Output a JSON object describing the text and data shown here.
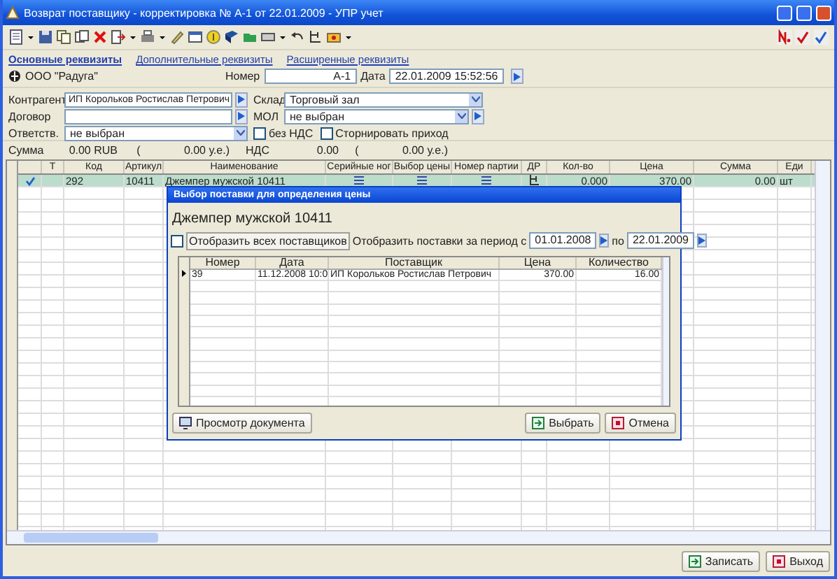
{
  "window": {
    "title": "Возврат поставщику - корректировка № А-1 от 22.01.2009 - УПР учет"
  },
  "tabs": [
    {
      "label": "Основные реквизиты",
      "selected": true
    },
    {
      "label": "Дополнительные реквизиты",
      "selected": false
    },
    {
      "label": "Расширенные реквизиты",
      "selected": false
    }
  ],
  "header": {
    "organization": "ООО \"Радуга\"",
    "number_label": "Номер",
    "number": "А-1",
    "date_label": "Дата",
    "date": "22.01.2009 15:52:56"
  },
  "left_fields": [
    {
      "label": "Контрагент",
      "value": "ИП Корольков Ростислав Петрович",
      "kind": "lookup"
    },
    {
      "label": "Договор",
      "kind": "lookup"
    },
    {
      "label": "Ответств.",
      "value": "не выбран",
      "kind": "combo"
    }
  ],
  "right_fields": [
    {
      "label": "Склад",
      "value": "Торговый зал",
      "kind": "combo"
    },
    {
      "label": "МОЛ",
      "value": "не выбран",
      "kind": "combo_lookup"
    }
  ],
  "options": [
    {
      "label": "без НДС",
      "checked": false
    },
    {
      "label": "Сторнировать приход",
      "checked": false
    }
  ],
  "totals": {
    "sum_label": "Сумма",
    "sum": "0.00 RUB",
    "sum_open": "(",
    "sum_alt": "0.00 у.е.)",
    "vat_label": "НДС",
    "vat": "0.00",
    "vat_open": "(",
    "vat_alt": "0.00 у.е.)"
  },
  "table": {
    "columns": [
      {
        "label": "Т",
        "kind": "blank"
      },
      {
        "label": "Код",
        "kind": "text"
      },
      {
        "label": "Артикул",
        "kind": "text"
      },
      {
        "label": "Наименование",
        "kind": "text"
      },
      {
        "label": "Серийные ног",
        "kind": "list_icon"
      },
      {
        "label": "Выбор цены",
        "kind": "list_icon"
      },
      {
        "label": "Номер партии",
        "kind": "list_icon"
      },
      {
        "label": "ДР",
        "kind": "doc_icon"
      },
      {
        "label": "Кол-во",
        "kind": "number"
      },
      {
        "label": "Цена",
        "kind": "number"
      },
      {
        "label": "Сумма",
        "kind": "number"
      },
      {
        "label": "Еди",
        "kind": "text"
      }
    ],
    "rows": [
      {
        "selected": true,
        "marked": true,
        "cells": [
          "",
          "292",
          "10411",
          "Джемпер мужской 10411",
          "",
          "",
          "",
          "",
          "0.000",
          "370.00",
          "0.00",
          "шт"
        ]
      }
    ]
  },
  "dialog": {
    "title": "Выбор поставки для определения цены",
    "product": "Джемпер мужской 10411",
    "all_suppliers": {
      "label": "Отобразить всех поставщиков",
      "checked": false
    },
    "period_label": "Отобразить поставки за период с",
    "date_from": "01.01.2008",
    "to_label": "по",
    "date_to": "22.01.2009",
    "columns": [
      {
        "label": "Номер",
        "kind": "text"
      },
      {
        "label": "Дата",
        "kind": "text"
      },
      {
        "label": "Поставщик",
        "kind": "text"
      },
      {
        "label": "Цена",
        "kind": "number"
      },
      {
        "label": "Количество",
        "kind": "number"
      }
    ],
    "rows": [
      {
        "selected": true,
        "cells": [
          "39",
          "11.12.2008 10:0",
          "ИП Корольков Ростислав Петрович",
          "370.00",
          "16.00"
        ]
      }
    ],
    "view_button": "Просмотр документа",
    "buttons": [
      {
        "label": "Выбрать",
        "kind": "ok"
      },
      {
        "label": "Отмена",
        "kind": "cancel"
      }
    ]
  },
  "buttons": [
    {
      "label": "Записать",
      "kind": "ok"
    },
    {
      "label": "Выход",
      "kind": "cancel"
    }
  ]
}
